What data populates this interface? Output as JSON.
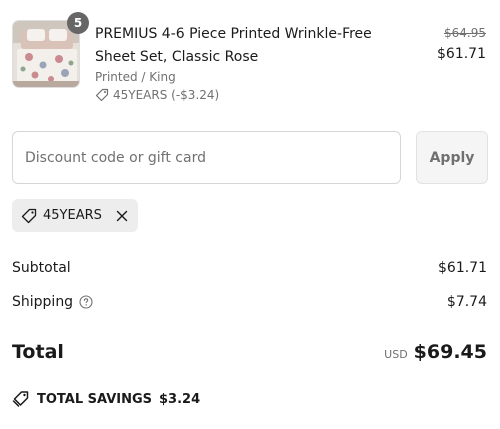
{
  "product": {
    "quantity": "5",
    "title": "PREMIUS 4-6 Piece Printed Wrinkle-Free Sheet Set, Classic Rose",
    "variant": "Printed / King",
    "discount_line": "45YEARS (-$3.24)",
    "compare_price": "$64.95",
    "price": "$61.71",
    "thumbnail": "floral-bedding-image"
  },
  "discount": {
    "placeholder": "Discount code or gift card",
    "value": "",
    "apply_label": "Apply",
    "applied_code": "45YEARS"
  },
  "summary": {
    "subtotal_label": "Subtotal",
    "subtotal_value": "$61.71",
    "shipping_label": "Shipping",
    "shipping_value": "$7.74",
    "total_label": "Total",
    "currency": "USD",
    "total_value": "$69.45",
    "savings_label": "TOTAL SAVINGS",
    "savings_value": "$3.24"
  },
  "colors": {
    "text": "#1a1a1a",
    "muted": "#707070",
    "border": "#d6d6d6",
    "chip_bg": "#ededed",
    "badge_bg": "#666666"
  }
}
